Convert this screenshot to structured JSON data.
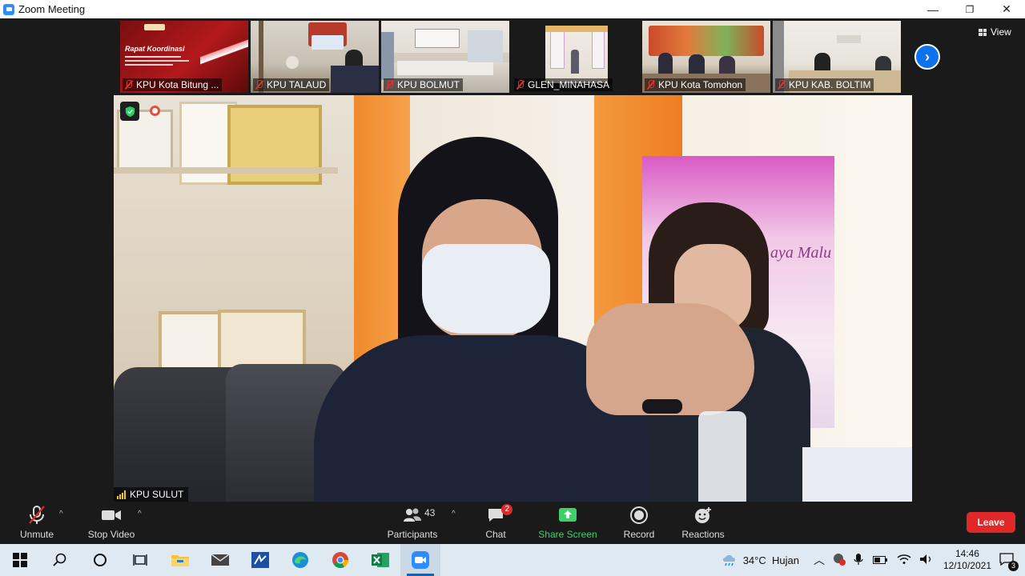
{
  "window": {
    "title": "Zoom Meeting",
    "minimize": "—",
    "restore": "❐",
    "close": "✕"
  },
  "strip": {
    "tiles": [
      {
        "name": "KPU Kota Bitung ..."
      },
      {
        "name": "KPU TALAUD"
      },
      {
        "name": "KPU BOLMUT"
      },
      {
        "name": "GLEN_MINAHASA"
      },
      {
        "name": "KPU Kota Tomohon"
      },
      {
        "name": "KPU KAB. BOLTIM"
      }
    ],
    "tile1_poster": {
      "heading": "Rapat Koordinasi"
    }
  },
  "view": {
    "label": "View"
  },
  "main": {
    "speaker": "KPU SULUT",
    "banner_text": "aya Malu"
  },
  "toolbar": {
    "unmute": "Unmute",
    "stop_video": "Stop Video",
    "participants": "Participants",
    "participants_count": "43",
    "chat": "Chat",
    "chat_badge": "2",
    "share_screen": "Share Screen",
    "record": "Record",
    "reactions": "Reactions",
    "leave": "Leave"
  },
  "taskbar": {
    "weather": "34°C  Hujan",
    "time": "14:46",
    "date": "12/10/2021",
    "notifications": "3"
  },
  "colors": {
    "accent_blue": "#0e72ed",
    "share_green": "#3ed16a",
    "leave_red": "#e02828",
    "muted_red": "#e03030"
  }
}
